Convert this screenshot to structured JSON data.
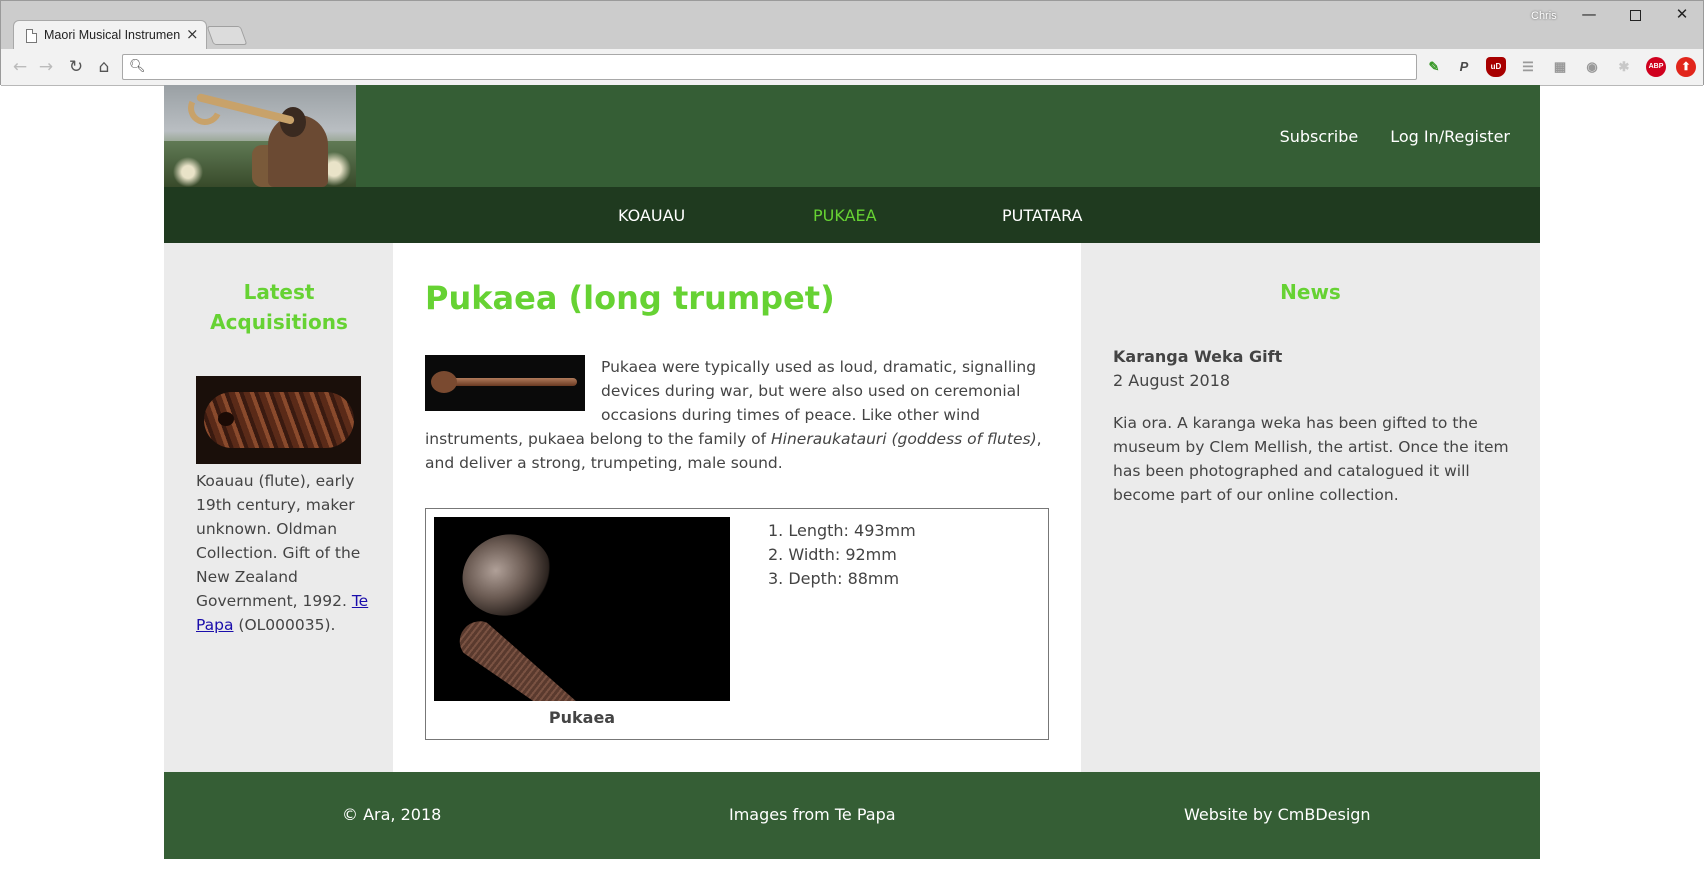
{
  "browser": {
    "tab_title": "Maori Musical Instrument",
    "tab_close": "×",
    "profile_name": "Chris",
    "address_value": "",
    "window_buttons": {
      "minimize": "—",
      "close": "✕"
    },
    "extensions": [
      "tag-assistant-icon",
      "paypal-icon",
      "ublock-icon",
      "reader-icon",
      "grid-icon",
      "camera-icon",
      "settings-icon",
      "adblock-icon",
      "upload-icon"
    ],
    "extension_labels": {
      "ublock": "uD",
      "adblock": "ABP"
    }
  },
  "header": {
    "links": [
      "Subscribe",
      "Log In/Register"
    ]
  },
  "nav": {
    "items": [
      {
        "label": "KOAUAU",
        "active": false
      },
      {
        "label": "PUKAEA",
        "active": true
      },
      {
        "label": "PUTATARA",
        "active": false
      }
    ]
  },
  "left": {
    "heading": "Latest Acquisitions",
    "caption_text": "Koauau (flute), early 19th century, maker unknown. Oldman Collection. Gift of the New Zealand Government, 1992. ",
    "caption_link": "Te Papa",
    "caption_suffix": " (OL000035)."
  },
  "main": {
    "title": "Pukaea (long trumpet)",
    "intro_before": "Pukaea were typically used as loud, dramatic, signalling devices during war, but were also used on ceremonial occasions during times of peace. Like other wind instruments, pukaea belong to the family of ",
    "intro_em": "Hineraukatauri (goddess of flutes)",
    "intro_after": ", and deliver a strong, trumpeting, male sound.",
    "figure_caption": "Pukaea",
    "specs": [
      "1. Length: 493mm",
      "2. Width: 92mm",
      "3. Depth: 88mm"
    ]
  },
  "right": {
    "heading": "News",
    "news_title": "Karanga Weka Gift",
    "news_date": "2 August 2018",
    "news_body": "Kia ora. A karanga weka has been gifted to the museum by Clem Mellish, the artist. Once the item has been photographed and catalogued it will become part of our online collection."
  },
  "footer": {
    "items": [
      "© Ara, 2018",
      "Images from Te Papa",
      "Website by CmBDesign"
    ]
  },
  "colors": {
    "header_green": "#355e35",
    "nav_dark_green": "#1f3a1f",
    "accent_green": "#66d233",
    "panel_grey": "#ebebeb"
  }
}
